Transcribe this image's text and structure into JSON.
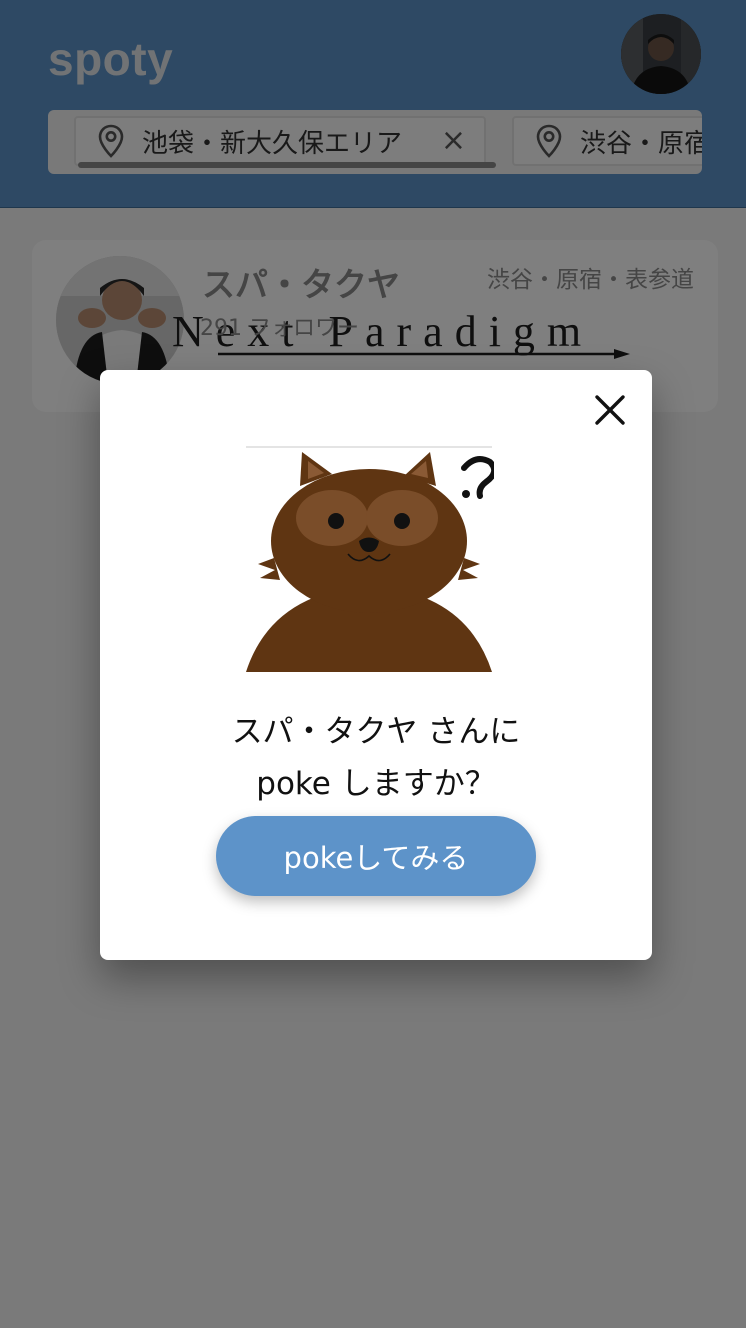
{
  "header": {
    "logo": "spoty",
    "avatar_icon": "user-avatar"
  },
  "filters": {
    "chips": [
      {
        "label": "池袋・新大久保エリア",
        "icon": "location-pin-icon",
        "close": "×"
      },
      {
        "label": "渋谷・原宿",
        "icon": "location-pin-icon"
      }
    ]
  },
  "list": {
    "cards": [
      {
        "name": "スパ・タクヤ",
        "followers": "291 フォロワー",
        "area": "渋谷・原宿・表参道",
        "banner_text": "Next Paradigm"
      }
    ]
  },
  "modal": {
    "close_icon": "close-icon",
    "illustration": "confused-tanuki",
    "line1": "スパ・タクヤ さんに",
    "line2": "poke しますか？",
    "button_label": "pokeしてみる"
  },
  "colors": {
    "header_bg": "#5d93c9",
    "button_bg": "#5d93c9",
    "tanuki_brown": "#6b3a12"
  }
}
